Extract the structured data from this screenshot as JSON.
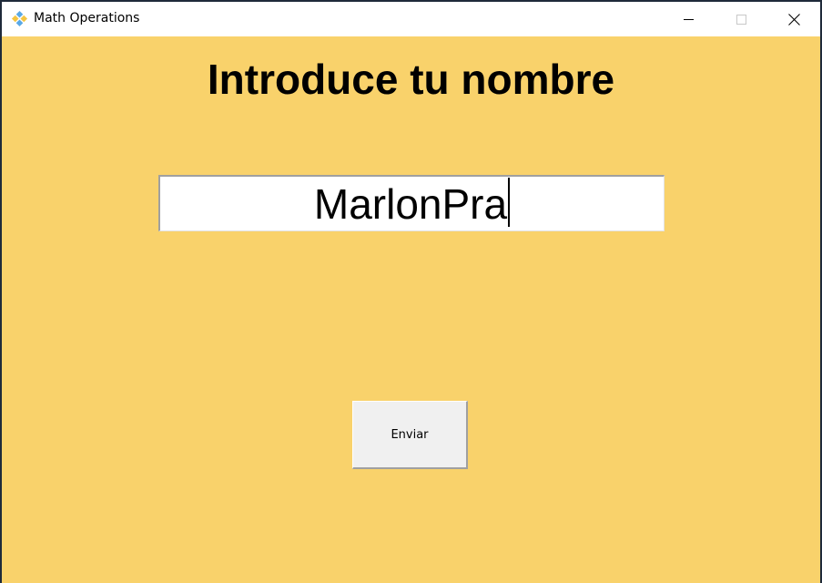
{
  "window": {
    "title": "Math Operations",
    "icon": "tk-feather-icon",
    "controls": [
      "minimize-icon",
      "maximize-icon",
      "close-icon"
    ]
  },
  "main": {
    "heading": "Introduce tu nombre",
    "name_input_value": "MarlonPra",
    "send_label": "Enviar"
  },
  "colors": {
    "background": "#f9d26b",
    "input_background": "#ffffff",
    "button_background": "#f0f0f0"
  }
}
